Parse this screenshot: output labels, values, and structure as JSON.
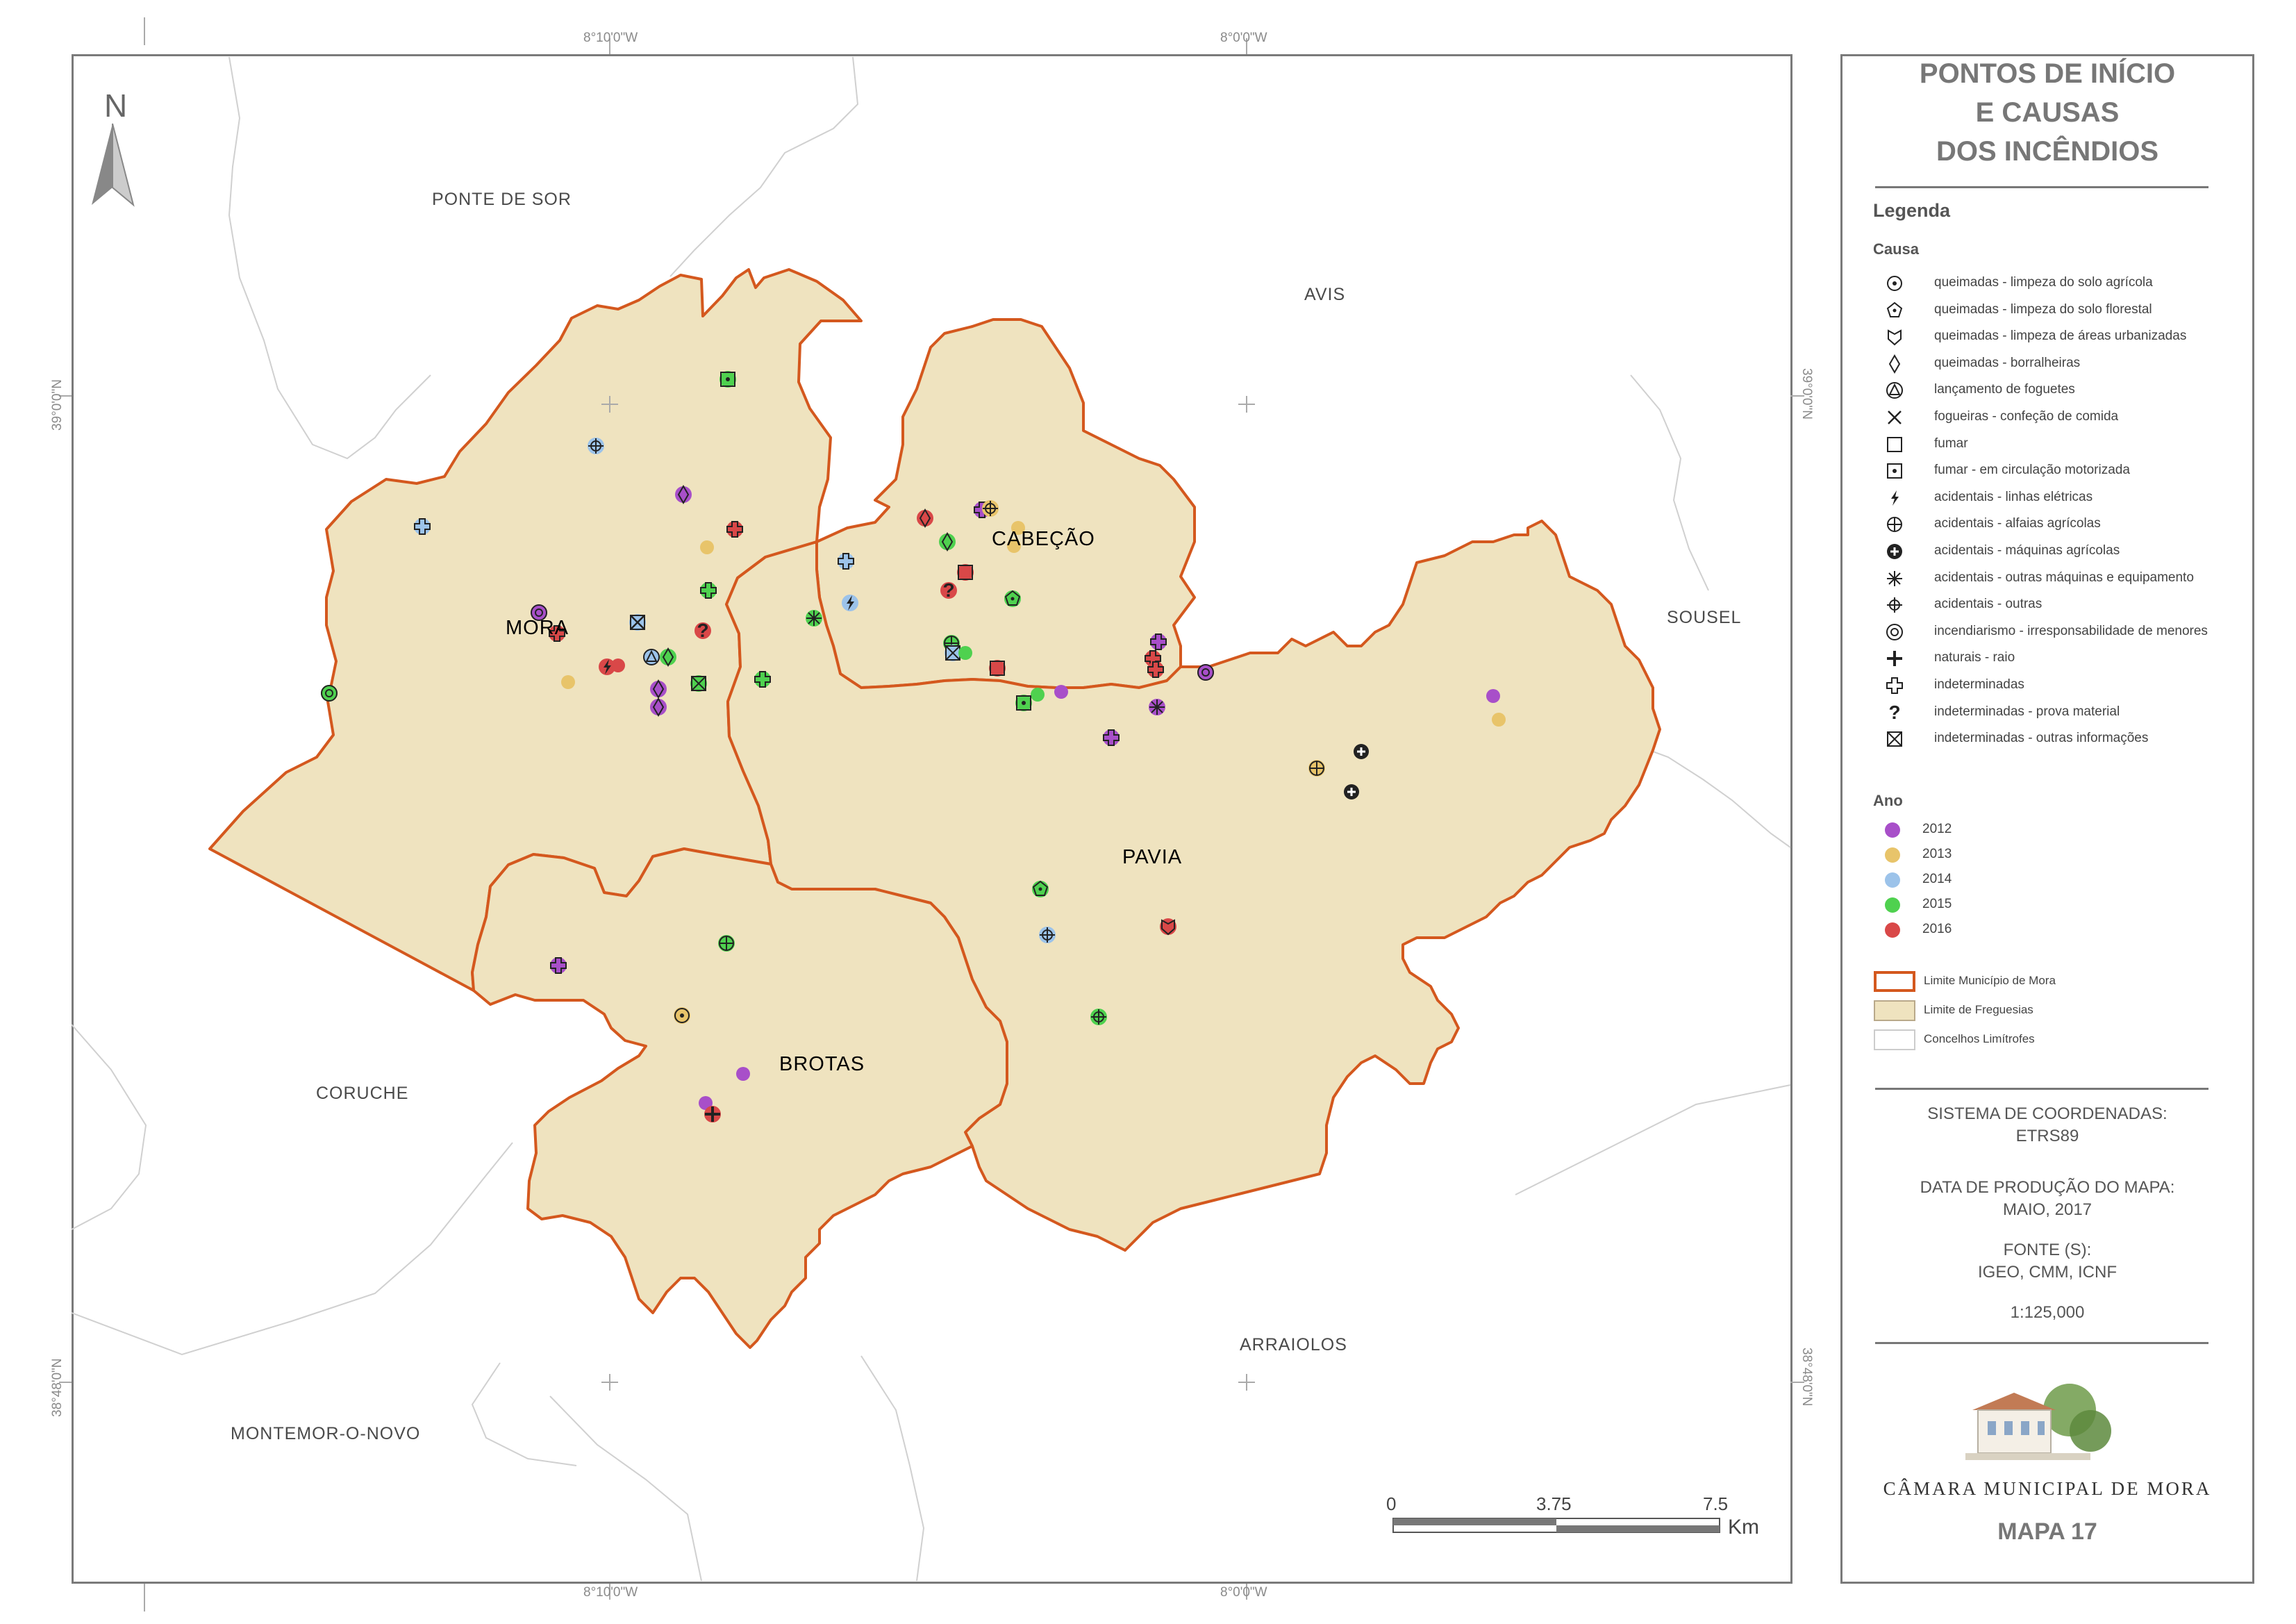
{
  "title_lines": [
    "PONTOS DE INÍCIO",
    "E CAUSAS",
    "DOS INCÊNDIOS"
  ],
  "legend_heading": "Legenda",
  "causa_heading": "Causa",
  "causes": [
    {
      "icon": "circle-star-icon",
      "label": "queimadas - limpeza do solo agrícola"
    },
    {
      "icon": "pentagon-icon",
      "label": "queimadas - limpeza do solo florestal"
    },
    {
      "icon": "shield-icon",
      "label": "queimadas - limpeza de áreas urbanizadas"
    },
    {
      "icon": "diamond-icon",
      "label": "queimadas - borralheiras"
    },
    {
      "icon": "triangle-circle-icon",
      "label": "lançamento de foguetes"
    },
    {
      "icon": "x-cross-icon",
      "label": "fogueiras - confeção de comida"
    },
    {
      "icon": "square-icon",
      "label": "fumar"
    },
    {
      "icon": "square-dot-icon",
      "label": "fumar - em circulação motorizada"
    },
    {
      "icon": "lightning-icon",
      "label": "acidentais - linhas elétricas"
    },
    {
      "icon": "circle-cross-icon",
      "label": "acidentais - alfaias agrícolas"
    },
    {
      "icon": "black-circle-plus-icon",
      "label": "acidentais - máquinas agrícolas"
    },
    {
      "icon": "asterisk-icon",
      "label": "acidentais - outras máquinas e equipamento"
    },
    {
      "icon": "crosshair-icon",
      "label": "acidentais - outras"
    },
    {
      "icon": "double-circle-icon",
      "label": "incendiarismo - irresponsabilidade de menores"
    },
    {
      "icon": "bold-plus-icon",
      "label": "naturais - raio"
    },
    {
      "icon": "outline-plus-icon",
      "label": "indeterminadas"
    },
    {
      "icon": "question-mark-icon",
      "label": "indeterminadas - prova material"
    },
    {
      "icon": "square-x-icon",
      "label": "indeterminadas - outras informações"
    }
  ],
  "ano_heading": "Ano",
  "years": [
    {
      "label": "2012",
      "color": "#a84fc9"
    },
    {
      "label": "2013",
      "color": "#e8c46a"
    },
    {
      "label": "2014",
      "color": "#9cc3ea"
    },
    {
      "label": "2015",
      "color": "#4fd14f"
    },
    {
      "label": "2016",
      "color": "#d94848"
    }
  ],
  "boundaries": [
    {
      "label": "Limite Município de Mora",
      "stroke": "#d4581e",
      "fill": "#ffffff"
    },
    {
      "label": "Limite de Freguesias",
      "stroke": "#b9a98a",
      "fill": "#efe3bf"
    },
    {
      "label": "Concelhos Limítrofes",
      "stroke": "#cccccc",
      "fill": "#ffffff"
    }
  ],
  "info": {
    "coord_label": "SISTEMA DE COORDENADAS:",
    "coord_value": "ETRS89",
    "date_label": "DATA DE PRODUÇÃO DO MAPA:",
    "date_value": "MAIO, 2017",
    "source_label": "FONTE (S):",
    "source_value": "IGEO, CMM, ICNF",
    "scale": "1:125,000"
  },
  "logo_text": "CÂMARA MUNICIPAL DE MORA",
  "map_number": "MAPA 17",
  "map": {
    "north": "N",
    "coords": {
      "lon1": "8°10'0\"W",
      "lon2": "8°0'0\"W",
      "lat1": "39°0'0\"N",
      "lat2": "38°48'0\"N"
    },
    "neighbours": [
      "PONTE DE SOR",
      "AVIS",
      "SOUSEL",
      "CORUCHE",
      "ARRAIOLOS",
      "MONTEMOR-O-NOVO"
    ],
    "parishes": [
      "MORA",
      "CABEÇÃO",
      "PAVIA",
      "BROTAS"
    ],
    "scalebar": {
      "ticks": [
        "0",
        "3.75",
        "7.5"
      ],
      "unit": "Km"
    }
  }
}
